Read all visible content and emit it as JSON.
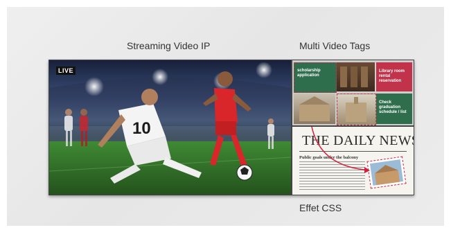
{
  "captions": {
    "streaming": "Streaming Video IP",
    "multi_tags": "Multi Video Tags",
    "css_effect": "Effet CSS"
  },
  "video": {
    "live_badge": "LIVE",
    "jersey_number": "10"
  },
  "tags_panel": {
    "tile1_text": "scholarship application",
    "tile2_text": "Library room rental reservation",
    "tile3_text": "Check graduation schedule / list"
  },
  "newspaper": {
    "masthead": "THE DAILY NEWS",
    "headline": "Public goals under the balcony"
  },
  "colors": {
    "tag_green": "#2f6e4d",
    "tag_red": "#c0334a",
    "accent_red": "#d21f3c"
  }
}
